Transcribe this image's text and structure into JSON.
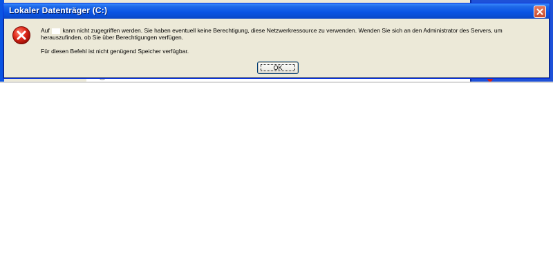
{
  "dialog": {
    "title": "Lokaler Datenträger (C:)",
    "message_prefix": "Auf",
    "message_line1": "kann nicht zugegriffen werden. Sie haben eventuell keine Berechtigung, diese Netzwerkressource zu verwenden. Wenden Sie sich an den Administrator des Servers, um herauszufinden, ob Sie über Berechtigungen verfügen.",
    "message_line2": "Für diesen Befehl ist nicht genügend Speicher verfügbar.",
    "ok_label": "OK",
    "close_icon": "close-icon",
    "error_icon": "error-icon"
  },
  "colors": {
    "titlebar": "#0b55e5",
    "dialog_bg": "#ece9d8",
    "close_button": "#d5603f",
    "error_red": "#e02a1a",
    "desktop_blue": "#1e51d8"
  }
}
